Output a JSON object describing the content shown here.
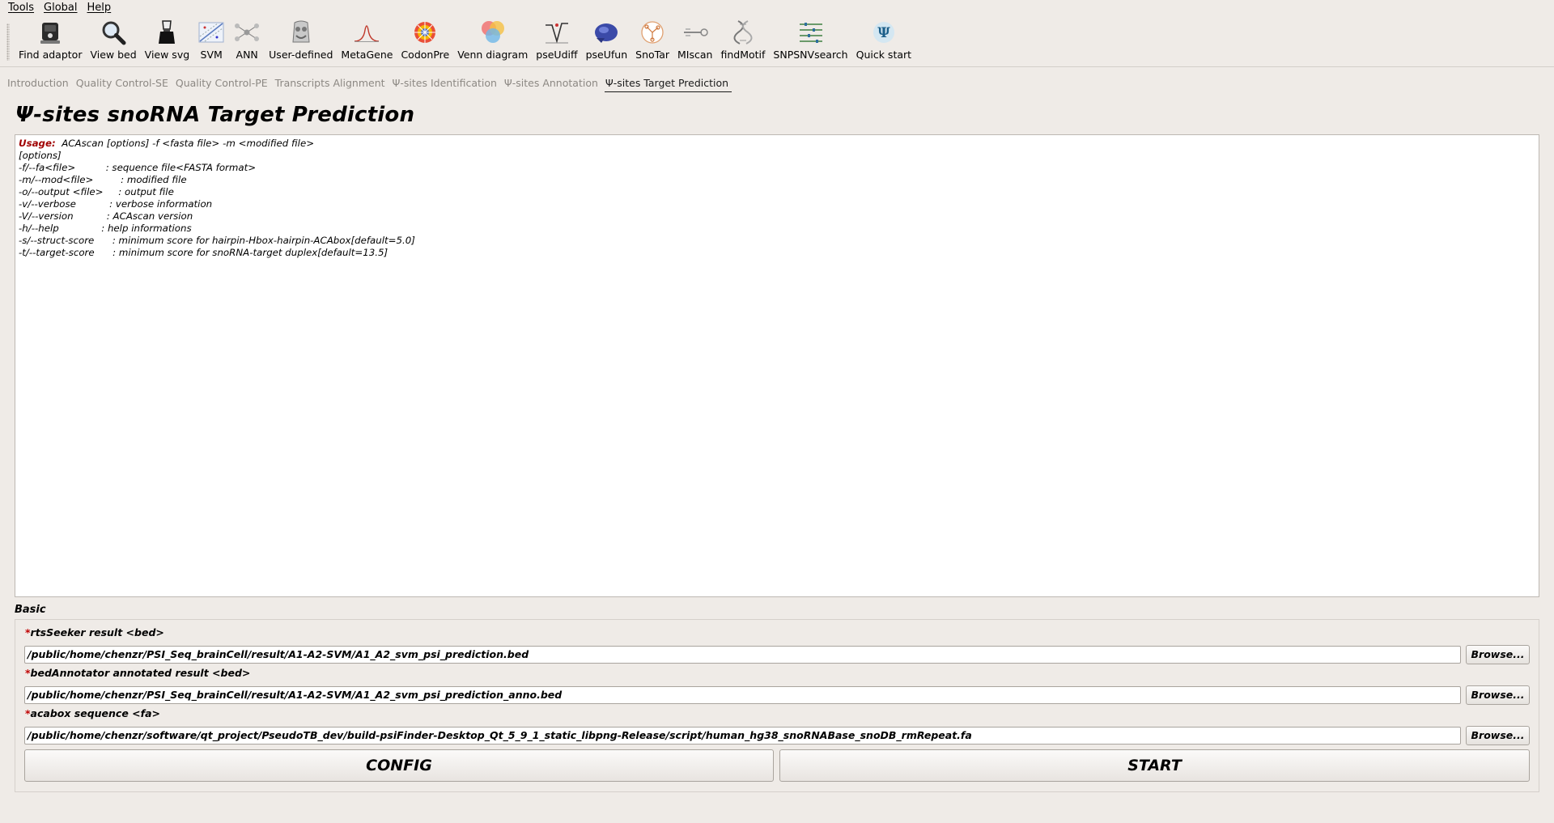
{
  "menubar": [
    "Tools",
    "Global",
    "Help"
  ],
  "toolbar": [
    {
      "label": "Find adaptor",
      "icon": "find-adaptor-icon"
    },
    {
      "label": "View bed",
      "icon": "magnifier-icon"
    },
    {
      "label": "View svg",
      "icon": "clip-icon"
    },
    {
      "label": "SVM",
      "icon": "svm-icon"
    },
    {
      "label": "ANN",
      "icon": "ann-network-icon"
    },
    {
      "label": "User-defined",
      "icon": "user-defined-icon"
    },
    {
      "label": "MetaGene",
      "icon": "metagene-peak-icon"
    },
    {
      "label": "CodonPre",
      "icon": "codon-wheel-icon"
    },
    {
      "label": "Venn diagram",
      "icon": "venn-icon"
    },
    {
      "label": "pseUdiff",
      "icon": "pseudiff-icon"
    },
    {
      "label": "pseUfun",
      "icon": "pseufun-icon"
    },
    {
      "label": "SnoTar",
      "icon": "snotar-icon"
    },
    {
      "label": "MIscan",
      "icon": "miscan-icon"
    },
    {
      "label": "findMotif",
      "icon": "findmotif-icon"
    },
    {
      "label": "SNPSNVsearch",
      "icon": "snpsnv-icon"
    },
    {
      "label": "Quick start",
      "icon": "psi-icon"
    }
  ],
  "tabs": [
    {
      "label": "Introduction",
      "active": false
    },
    {
      "label": "Quality Control-SE",
      "active": false
    },
    {
      "label": "Quality Control-PE",
      "active": false
    },
    {
      "label": "Transcripts Alignment",
      "active": false
    },
    {
      "label": "Ψ-sites Identification",
      "active": false
    },
    {
      "label": "Ψ-sites Annotation",
      "active": false
    },
    {
      "label": "Ψ-sites Target Prediction",
      "active": true
    }
  ],
  "page": {
    "title": "Ψ-sites snoRNA Target Prediction"
  },
  "usage": {
    "label": "Usage:",
    "command": "  ACAscan [options] -f <fasta file> -m <modified file>",
    "lines": [
      "[options]",
      "-f/--fa<file>          : sequence file<FASTA format>",
      "-m/--mod<file>         : modified file",
      "-o/--output <file>     : output file",
      "-v/--verbose           : verbose information",
      "-V/--version           : ACAscan version",
      "-h/--help              : help informations",
      "-s/--struct-score      : minimum score for hairpin-Hbox-hairpin-ACAbox[default=5.0]",
      "-t/--target-score      : minimum score for snoRNA-target duplex[default=13.5]"
    ]
  },
  "basic": {
    "title": "Basic",
    "required_mark": "*",
    "fields": [
      {
        "label": "rtsSeeker result <bed>",
        "value": "/public/home/chenzr/PSI_Seq_brainCell/result/A1-A2-SVM/A1_A2_svm_psi_prediction.bed"
      },
      {
        "label": "bedAnnotator annotated result <bed>",
        "value": "/public/home/chenzr/PSI_Seq_brainCell/result/A1-A2-SVM/A1_A2_svm_psi_prediction_anno.bed"
      },
      {
        "label": "acabox sequence <fa>",
        "value": "/public/home/chenzr/software/qt_project/PseudoTB_dev/build-psiFinder-Desktop_Qt_5_9_1_static_libpng-Release/script/human_hg38_snoRNABase_snoDB_rmRepeat.fa"
      }
    ],
    "browse_label": "Browse...",
    "config_label": "CONFIG",
    "start_label": "START"
  }
}
